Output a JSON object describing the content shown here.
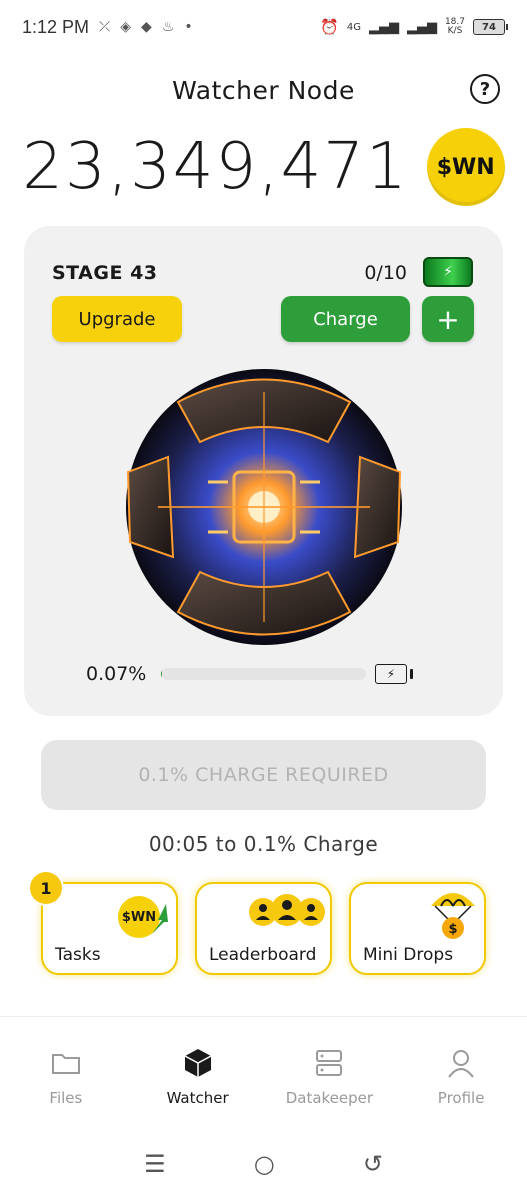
{
  "status_bar": {
    "time": "1:12 PM",
    "net_speed_value": "18.7",
    "net_speed_unit": "K/S",
    "network": "4G",
    "battery": "74"
  },
  "header": {
    "title": "Watcher Node"
  },
  "balance": {
    "value": "23,349,471",
    "coin_label": "$WN"
  },
  "stage": {
    "label": "STAGE 43",
    "charges": "0/10",
    "upgrade_label": "Upgrade",
    "charge_label": "Charge",
    "plus_label": "+",
    "progress_text": "0.07%",
    "progress_fraction": 0.0007
  },
  "charge_required": {
    "label": "0.1% CHARGE REQUIRED"
  },
  "timer": {
    "text": "00:05 to 0.1% Charge"
  },
  "features": {
    "tasks": {
      "label": "Tasks",
      "badge": "1",
      "coin": "$WN"
    },
    "leaderboard": {
      "label": "Leaderboard"
    },
    "minidrops": {
      "label": "Mini Drops",
      "coin_symbol": "$"
    }
  },
  "nav": {
    "items": [
      {
        "label": "Files",
        "icon": "folder-icon"
      },
      {
        "label": "Watcher",
        "icon": "cube-icon"
      },
      {
        "label": "Datakeeper",
        "icon": "server-icon"
      },
      {
        "label": "Profile",
        "icon": "user-icon"
      }
    ],
    "active_index": 1
  },
  "colors": {
    "accent_yellow": "#f7d10c",
    "accent_green": "#2e9e3b",
    "card_bg": "#f1f1f1"
  }
}
